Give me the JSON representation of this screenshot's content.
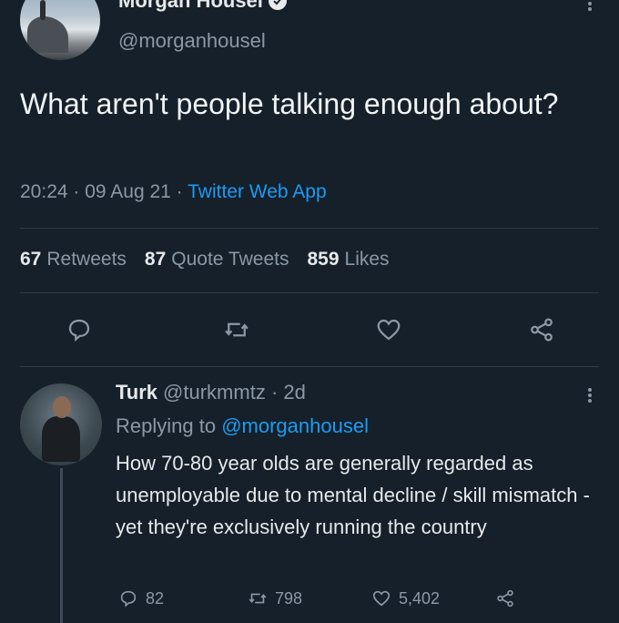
{
  "tweet": {
    "author_name": "Morgan Housel",
    "author_handle": "@morganhousel",
    "text": "What aren't people talking enough about?",
    "time": "20:24",
    "date": "09 Aug 21",
    "source": "Twitter Web App",
    "stats": {
      "retweets_count": "67",
      "retweets_label": "Retweets",
      "quotes_count": "87",
      "quotes_label": "Quote Tweets",
      "likes_count": "859",
      "likes_label": "Likes"
    }
  },
  "reply": {
    "author_name": "Turk",
    "author_handle": "@turkmmtz",
    "age": "2d",
    "replying_prefix": "Replying to",
    "replying_handle": "@morganhousel",
    "text": "How 70-80 year olds are generally regarded as unemployable due to mental decline / skill mismatch - yet they're exclusively running the country",
    "replies": "82",
    "retweets": "798",
    "likes": "5,402"
  },
  "colors": {
    "background": "#15202b",
    "text": "#e7e9ea",
    "muted": "#8b98a5",
    "accent": "#1d9bf0"
  },
  "icons": [
    "verified-icon",
    "more-icon",
    "reply-icon",
    "retweet-icon",
    "like-icon",
    "share-icon"
  ]
}
